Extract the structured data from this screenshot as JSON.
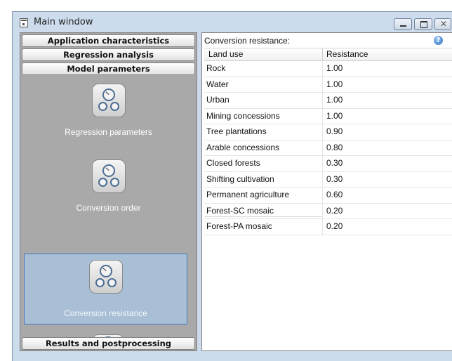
{
  "window": {
    "title": "Main window",
    "icon": "window-app-icon",
    "controls": {
      "minimize": "minimize-icon",
      "maximize": "maximize-icon",
      "close": "close-icon"
    }
  },
  "sidebar": {
    "headers": [
      "Application characteristics",
      "Regression analysis",
      "Model parameters"
    ],
    "items": [
      {
        "label": "Regression parameters",
        "icon": "gauges-icon",
        "selected": false
      },
      {
        "label": "Conversion order",
        "icon": "gauges-icon",
        "selected": false
      },
      {
        "label": "Conversion resistance",
        "icon": "gauges-icon",
        "selected": true
      }
    ],
    "footer_header": "Results and postprocessing"
  },
  "content": {
    "caption": "Conversion resistance:",
    "help_icon": "help-icon",
    "help_glyph": "?",
    "columns": [
      "Land use",
      "Resistance"
    ],
    "rows": [
      [
        "Rock",
        "1.00"
      ],
      [
        "Water",
        "1.00"
      ],
      [
        "Urban",
        "1.00"
      ],
      [
        "Mining concessions",
        "1.00"
      ],
      [
        "Tree plantations",
        "0.90"
      ],
      [
        "Arable concessions",
        "0.80"
      ],
      [
        "Closed forests",
        "0.30"
      ],
      [
        "Shifting cultivation",
        "0.30"
      ],
      [
        "Permanent agriculture",
        "0.60"
      ],
      [
        "Forest-SC mosaic",
        "0.20"
      ],
      [
        "Forest-PA mosaic",
        "0.20"
      ]
    ]
  },
  "colors": {
    "window_frame": "#ccdcec",
    "sidebar_bg": "#a9a9a9",
    "selected_item_bg": "#a8bfd6",
    "selected_item_border": "#4a7cc0"
  }
}
